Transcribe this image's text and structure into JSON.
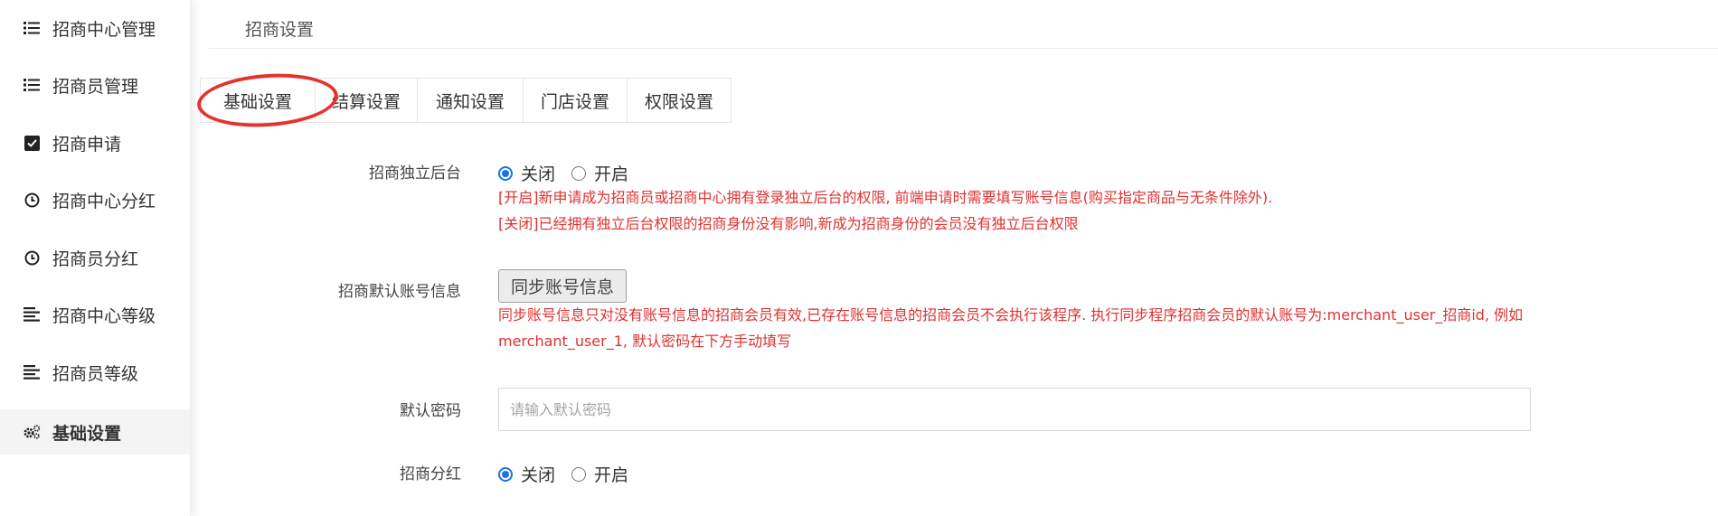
{
  "sidebar": {
    "items": [
      {
        "label": "招商中心管理",
        "icon": "list-icon"
      },
      {
        "label": "招商员管理",
        "icon": "list-icon"
      },
      {
        "label": "招商申请",
        "icon": "checkbox-icon"
      },
      {
        "label": "招商中心分红",
        "icon": "clock-icon"
      },
      {
        "label": "招商员分红",
        "icon": "clock-icon"
      },
      {
        "label": "招商中心等级",
        "icon": "align-left-icon"
      },
      {
        "label": "招商员等级",
        "icon": "align-left-icon"
      },
      {
        "label": "基础设置",
        "icon": "gears-icon",
        "active": true
      }
    ]
  },
  "header": {
    "title": "招商设置"
  },
  "tabs": [
    "基础设置",
    "结算设置",
    "通知设置",
    "门店设置",
    "权限设置"
  ],
  "active_tab": "基础设置",
  "form": {
    "independent_backend": {
      "label": "招商独立后台",
      "options": [
        "关闭",
        "开启"
      ],
      "selected": "关闭",
      "help_lines": [
        "[开启]新申请成为招商员或招商中心拥有登录独立后台的权限, 前端申请时需要填写账号信息(购买指定商品与无条件除外).",
        "[关闭]已经拥有独立后台权限的招商身份没有影响,新成为招商身份的会员没有独立后台权限"
      ]
    },
    "default_account": {
      "label": "招商默认账号信息",
      "button": "同步账号信息",
      "help_lines": [
        "同步账号信息只对没有账号信息的招商会员有效,已存在账号信息的招商会员不会执行该程序. 执行同步程序招商会员的默认账号为:merchant_user_招商id, 例如",
        "merchant_user_1, 默认密码在下方手动填写"
      ]
    },
    "default_password": {
      "label": "默认密码",
      "value": "",
      "placeholder": "请输入默认密码"
    },
    "dividend": {
      "label": "招商分红",
      "options": [
        "关闭",
        "开启"
      ],
      "selected": "关闭"
    }
  },
  "colors": {
    "help_text": "#e03131",
    "radio_accent": "#1a73e8",
    "annotation_circle": "#e5322d"
  }
}
